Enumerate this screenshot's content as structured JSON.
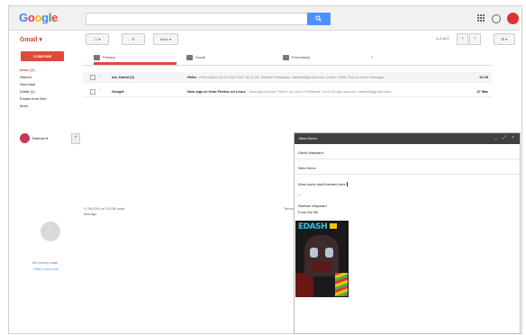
{
  "header": {
    "logo": {
      "G": "G",
      "o1": "o",
      "o2": "o",
      "g": "g",
      "l": "l",
      "e": "e"
    },
    "search_placeholder": ""
  },
  "toolbar": {
    "app_label": "Gmail",
    "select_label": "",
    "more_label": "More",
    "pager": "1–2 of 2"
  },
  "sidebar": {
    "compose_label": "COMPOSE",
    "items": [
      {
        "label": "Inbox (1)",
        "active": true
      },
      {
        "label": "Starred"
      },
      {
        "label": "Sent Mail"
      },
      {
        "label": "Drafts (1)"
      },
      {
        "label": "Emails from Bert"
      },
      {
        "label": "More"
      }
    ],
    "hangouts_user": "Raebee",
    "no_chats": "No recent chats",
    "start_chat": "Start a new one"
  },
  "tabs": [
    {
      "label": "Primary",
      "active": true
    },
    {
      "label": "Social"
    },
    {
      "label": "Promotions"
    }
  ],
  "emails": [
    {
      "sender": "me, David (2)",
      "subject": "Hello",
      "snippet": " - Hello back! On 19 April 2017 at 11:35, Raebee Wayward <raebee@gmail.com> wrote: Hello. This is a test message. -- ",
      "time": "11:39",
      "unread": true
    },
    {
      "sender": "Google",
      "subject": "New sign-in from Firefox on Linux",
      "snippet": " - New sign-in from Firefox on Linux Hi Raebee, Your Google account <raebee@gmail.com>",
      "time": "27 Mar",
      "unread": false
    }
  ],
  "footer": {
    "usage": "0 GB (0%) of 15 GB used\nManage",
    "last_activity": "Terms"
  },
  "compose_window": {
    "title": "New Demo",
    "to": "David Wayward",
    "subject": "New Demo",
    "body_line": "Wow some stuff inserted here",
    "body_dash": "--",
    "sig_name": "Raebee Wayward",
    "sig_line": "From the Bit",
    "magazine_title": "EDASH"
  },
  "colors": {
    "accent_red": "#dd4b39",
    "search_blue": "#4d90fe",
    "compose_header": "#404040"
  }
}
